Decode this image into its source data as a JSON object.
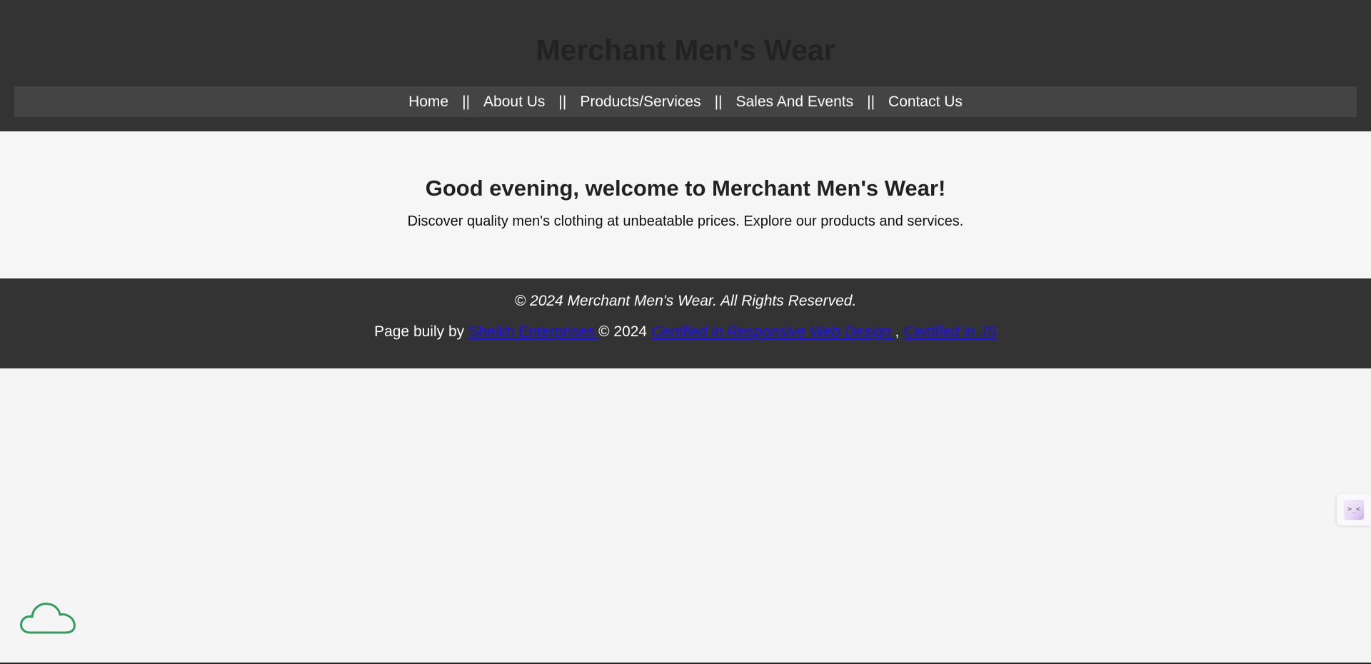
{
  "header": {
    "site_title": "Merchant Men's Wear"
  },
  "nav": {
    "items": [
      {
        "label": "Home"
      },
      {
        "label": "About Us"
      },
      {
        "label": "Products/Services"
      },
      {
        "label": "Sales And Events"
      },
      {
        "label": "Contact Us"
      }
    ],
    "separator": "||"
  },
  "hero": {
    "heading": "Good evening, welcome to Merchant Men's Wear!",
    "text": "Discover quality men's clothing at unbeatable prices. Explore our products and services."
  },
  "footer": {
    "copyright": "© 2024 Merchant Men's Wear. All Rights Reserved.",
    "credit_prefix": "Page buily by ",
    "credit_link": "Sheikh Enterprises ",
    "credit_year": " © 2024 ",
    "cert_link_1": "Certified in Responsive Web Design ",
    "cert_separator": " , ",
    "cert_link_2": "Certified in JS"
  },
  "widgets": {
    "side_widget_glyph": ">_<",
    "cloud_icon": "cloud-icon"
  },
  "colors": {
    "header_bg": "#333333",
    "nav_bg": "#444444",
    "link": "#1a0dff",
    "cloud": "#2e9e5b"
  }
}
